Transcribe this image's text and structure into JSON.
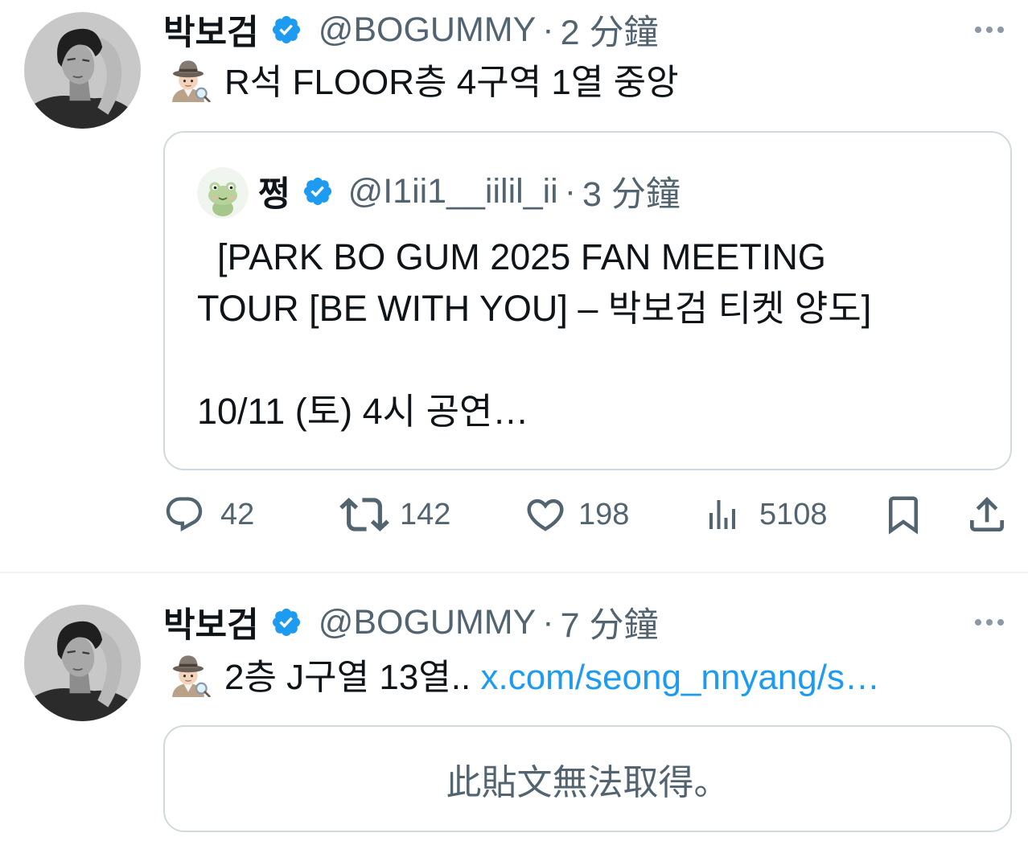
{
  "tweets": [
    {
      "author": {
        "name": "박보검",
        "handle": "@BOGUMMY",
        "verified": true
      },
      "separator": "·",
      "time": "2 分鐘",
      "body": {
        "emoji": "detective-emoji-icon",
        "text": "R석 FLOOR층 4구역 1열 중앙"
      },
      "quote": {
        "author": {
          "name": "쩡",
          "handle": "@I1ii1__iilil_ii",
          "verified": true
        },
        "separator": "·",
        "time": "3 分鐘",
        "text": "  [PARK BO GUM 2025 FAN MEETING TOUR [BE WITH YOU] – 박보검 티켓 양도]\n\n10/11 (토) 4시 공연…"
      },
      "actions": {
        "reply": {
          "icon": "reply-icon",
          "count": "42"
        },
        "repost": {
          "icon": "repost-icon",
          "count": "142"
        },
        "like": {
          "icon": "heart-icon",
          "count": "198"
        },
        "views": {
          "icon": "views-icon",
          "count": "5108"
        },
        "bookmark": {
          "icon": "bookmark-icon"
        },
        "share": {
          "icon": "share-icon"
        }
      }
    },
    {
      "author": {
        "name": "박보검",
        "handle": "@BOGUMMY",
        "verified": true
      },
      "separator": "·",
      "time": "7 分鐘",
      "body": {
        "emoji": "detective-emoji-icon",
        "text": "2층 J구열 13열..",
        "link": "x.com/seong_nnyang/s…"
      },
      "unavailable": "此貼文無法取得。"
    }
  ],
  "icons": {
    "more": "more-horizontal-icon",
    "verified": "verified-badge-icon"
  },
  "colors": {
    "text": "#0f1419",
    "secondary": "#536471",
    "accent": "#1d9bf0",
    "border": "#cfd9de",
    "divider": "#eff3f4",
    "more": "#8b98a5"
  }
}
